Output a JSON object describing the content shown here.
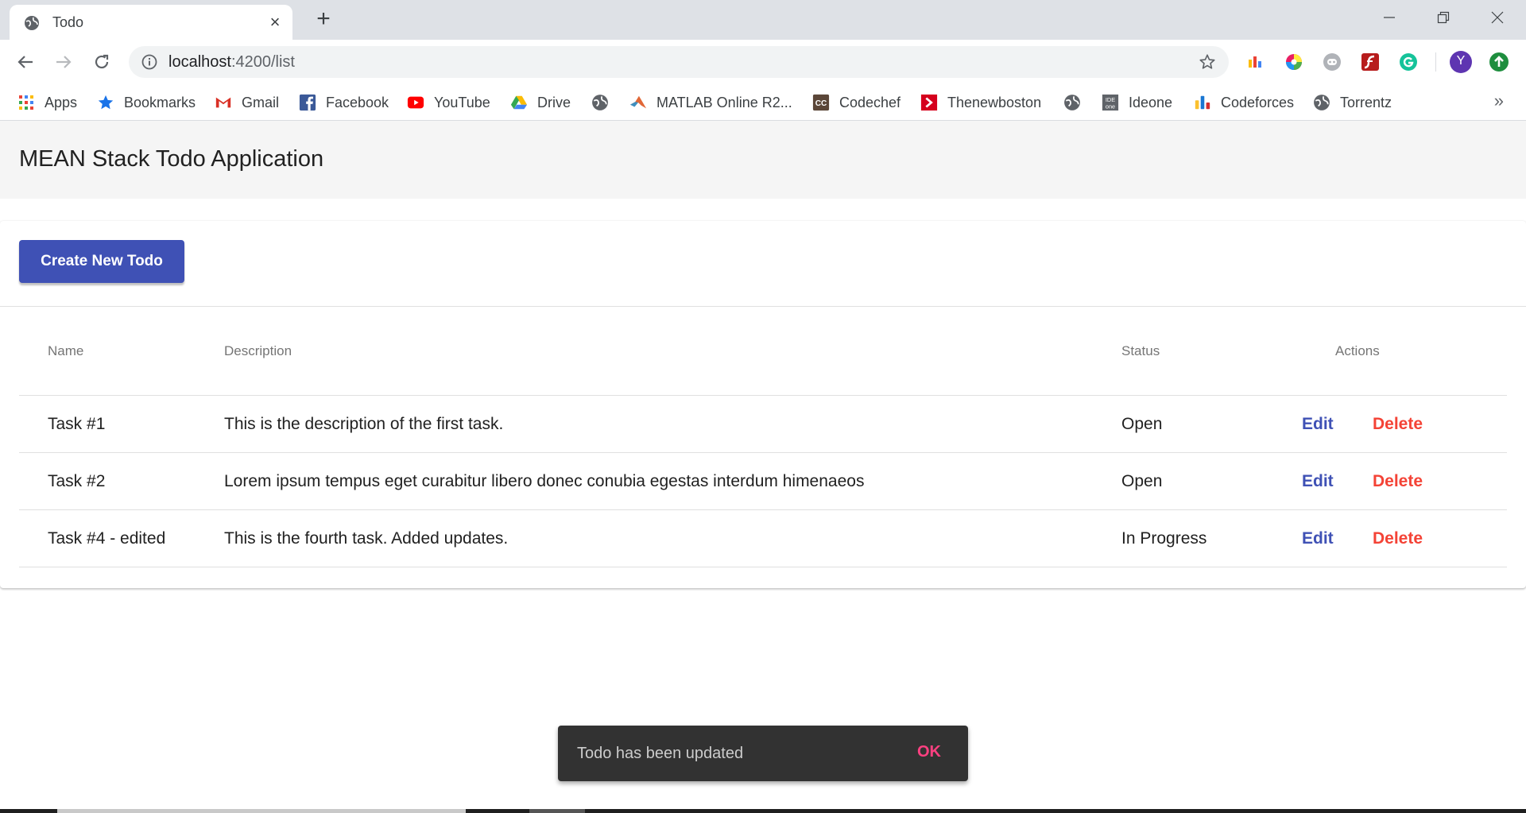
{
  "browser": {
    "tab": {
      "title": "Todo",
      "favicon": "globe-icon",
      "close": "×"
    },
    "new_tab": "+",
    "url": {
      "host": "localhost",
      "path": ":4200/list"
    },
    "bookmarks": [
      {
        "label": "Apps",
        "icon": "apps-grid-icon"
      },
      {
        "label": "Bookmarks",
        "icon": "star-icon"
      },
      {
        "label": "Gmail",
        "icon": "gmail-icon"
      },
      {
        "label": "Facebook",
        "icon": "facebook-icon"
      },
      {
        "label": "YouTube",
        "icon": "youtube-icon"
      },
      {
        "label": "Drive",
        "icon": "drive-icon"
      },
      {
        "label": "",
        "icon": "globe-icon"
      },
      {
        "label": "MATLAB Online R2...",
        "icon": "matlab-icon"
      },
      {
        "label": "Codechef",
        "icon": "codechef-icon"
      },
      {
        "label": "Thenewboston",
        "icon": "thenewboston-icon"
      },
      {
        "label": "",
        "icon": "globe-icon"
      },
      {
        "label": "Ideone",
        "icon": "ideone-icon"
      },
      {
        "label": "Codeforces",
        "icon": "codeforces-icon"
      },
      {
        "label": "Torrentz",
        "icon": "globe-icon"
      }
    ],
    "bookmarks_more": "»",
    "profile_initial": "Y"
  },
  "app": {
    "title": "MEAN Stack Todo Application",
    "create_button": "Create New Todo",
    "table": {
      "headers": {
        "name": "Name",
        "description": "Description",
        "status": "Status",
        "actions": "Actions"
      },
      "rows": [
        {
          "name": "Task #1",
          "description": "This is the description of the first task.",
          "status": "Open",
          "edit": "Edit",
          "delete": "Delete"
        },
        {
          "name": "Task #2",
          "description": "Lorem ipsum tempus eget curabitur libero donec conubia egestas interdum himenaeos",
          "status": "Open",
          "edit": "Edit",
          "delete": "Delete"
        },
        {
          "name": "Task #4 - edited",
          "description": "This is the fourth task. Added updates.",
          "status": "In Progress",
          "edit": "Edit",
          "delete": "Delete"
        }
      ]
    }
  },
  "snackbar": {
    "message": "Todo has been updated",
    "action": "OK"
  },
  "colors": {
    "primary": "#3f51b5",
    "warn": "#f44336",
    "accent": "#ff4081",
    "header_bg": "#f5f5f5",
    "snackbar_bg": "#323232"
  }
}
